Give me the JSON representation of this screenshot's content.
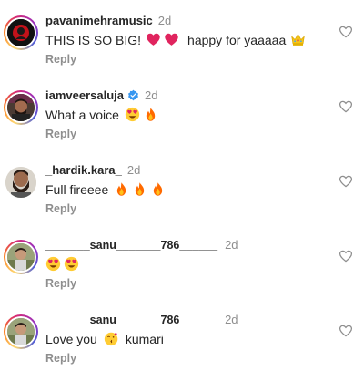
{
  "colors": {
    "username": "#262626",
    "meta": "#8e8e8e",
    "verified": "#3897f0",
    "fire": "#ff7a00",
    "heart_emoji": "#e0245e"
  },
  "comments": [
    {
      "username": "pavanimehramusic",
      "time": "2d",
      "text": "THIS IS SO BIG!",
      "text_after_hearts": "happy for yaaaaa",
      "emojis": [
        "red-heart",
        "red-heart",
        "crown"
      ],
      "reply_label": "Reply"
    },
    {
      "username": "iamveersaluja",
      "verified": true,
      "time": "2d",
      "text": "What a voice",
      "emojis": [
        "heart-eyes",
        "fire"
      ],
      "reply_label": "Reply"
    },
    {
      "username": "_hardik.kara_",
      "time": "2d",
      "text": "Full fireeee",
      "emojis": [
        "fire",
        "fire",
        "fire"
      ],
      "reply_label": "Reply"
    },
    {
      "username": "_______sanu_______786______",
      "time": "2d",
      "text": "",
      "emojis": [
        "heart-eyes",
        "heart-eyes"
      ],
      "reply_label": "Reply"
    },
    {
      "username": "_______sanu_______786______",
      "time": "2d",
      "text": "Love you",
      "text_after_emoji": "kumari",
      "emojis": [
        "kissing-heart"
      ],
      "reply_label": "Reply"
    }
  ]
}
